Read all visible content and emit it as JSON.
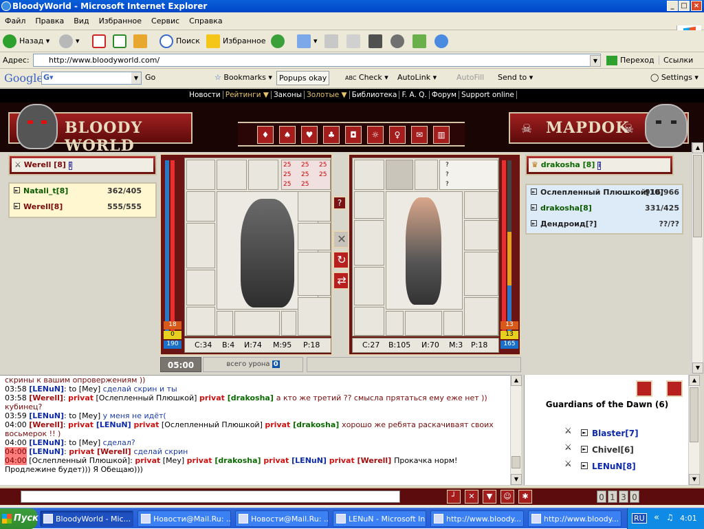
{
  "window": {
    "title": "BloodyWorld - Microsoft Internet Explorer",
    "min": "_",
    "max": "□",
    "close": "×"
  },
  "menu": [
    "Файл",
    "Правка",
    "Вид",
    "Избранное",
    "Сервис",
    "Справка"
  ],
  "toolbar": {
    "back": "Назад",
    "search": "Поиск",
    "favorites": "Избранное"
  },
  "address": {
    "label": "Адрес:",
    "url": "http://www.bloodyworld.com/",
    "go": "Переход",
    "links": "Ссылки"
  },
  "google": {
    "logo": "Google",
    "go": "Go",
    "bookmarks": "Bookmarks",
    "popups": "Popups okay",
    "check": "Check",
    "autolink": "AutoLink",
    "autofill": "AutoFill",
    "sendto": "Send to",
    "settings": "Settings"
  },
  "topnav": [
    "Новости",
    "Рейтинги ▼",
    "Законы",
    "Золотые ▼",
    "Библиотека",
    "F. A. Q.",
    "Форум",
    "Support online"
  ],
  "banner": {
    "left_title": "BLOODY WORLD",
    "right_title": "MAPDOK"
  },
  "navbuttons": [
    "♦",
    "♠",
    "♥",
    "♣",
    "◘",
    "☼",
    "♀",
    "✉",
    "▥"
  ],
  "left_player": {
    "name": "Werell [8]"
  },
  "right_player": {
    "name": "drakosha [8]"
  },
  "left_team": [
    {
      "name": "Natali_t[8]",
      "hp": "362/405"
    },
    {
      "name": "Werell[8]",
      "hp": "555/555"
    }
  ],
  "right_team": [
    {
      "name": "Ослепленный Плюшкой[10]",
      "hp": "916/966"
    },
    {
      "name": "drakosha[8]",
      "hp": "331/425"
    },
    {
      "name": "Дендроид[?]",
      "hp": "??/??"
    }
  ],
  "left_char": {
    "hp": "190",
    "mana": "0",
    "bar_top": "18",
    "stats": {
      "s": "С:34",
      "v": "В:4",
      "i": "И:74",
      "m": "М:95",
      "r": "Р:18"
    },
    "buff": "25"
  },
  "right_char": {
    "hp": "165",
    "mana": "13",
    "bar_top": "13",
    "stats": {
      "s": "С:27",
      "v": "В:105",
      "i": "И:70",
      "m": "М:3",
      "r": "Р:18"
    },
    "unknown": "?"
  },
  "mid": {
    "help": "?",
    "b1": "✕",
    "b2": "↻",
    "b3": "⇄"
  },
  "timer": "05:00",
  "damage": {
    "label": "всего урона",
    "value": "0"
  },
  "chat": [
    {
      "time": "",
      "parts": [
        {
          "t": "скрины к вашим опровержениям ))",
          "c": "msg"
        }
      ]
    },
    {
      "time": "03:58",
      "parts": [
        {
          "t": "[LENuN]",
          "c": "usr"
        },
        {
          "t": ": ",
          "c": "blk"
        },
        {
          "t": "to",
          "c": "blk"
        },
        {
          "t": " [Мey] ",
          "c": "blk"
        },
        {
          "t": "сделай скрин и ты",
          "c": "msgb"
        }
      ]
    },
    {
      "time": "03:58",
      "parts": [
        {
          "t": "[Werell]",
          "c": "usr2"
        },
        {
          "t": ": ",
          "c": "blk"
        },
        {
          "t": "privat",
          "c": "priv"
        },
        {
          "t": " [Ослепленный Плюшкой] ",
          "c": "blk"
        },
        {
          "t": "privat",
          "c": "priv"
        },
        {
          "t": " [drakosha] ",
          "c": "gr"
        },
        {
          "t": "а кто же третий ?? смысла прятаться ему еже нет )) кубинец?",
          "c": "msg"
        }
      ]
    },
    {
      "time": "03:59",
      "parts": [
        {
          "t": "[LENuN]",
          "c": "usr"
        },
        {
          "t": ": ",
          "c": "blk"
        },
        {
          "t": "to",
          "c": "blk"
        },
        {
          "t": " [Мey] ",
          "c": "blk"
        },
        {
          "t": "у меня не идёт(",
          "c": "msgb"
        }
      ]
    },
    {
      "time": "04:00",
      "parts": [
        {
          "t": "[Werell]",
          "c": "usr2"
        },
        {
          "t": ": ",
          "c": "blk"
        },
        {
          "t": "privat",
          "c": "priv"
        },
        {
          "t": " [LENuN] ",
          "c": "usr"
        },
        {
          "t": "privat",
          "c": "priv"
        },
        {
          "t": " [Ослепленный Плюшкой] ",
          "c": "blk"
        },
        {
          "t": "privat",
          "c": "priv"
        },
        {
          "t": " [drakosha] ",
          "c": "gr"
        },
        {
          "t": "хорошо же ребята раскачиваят своих восьмерок !! )",
          "c": "msg"
        }
      ]
    },
    {
      "time": "04:00",
      "parts": [
        {
          "t": "[LENuN]",
          "c": "usr"
        },
        {
          "t": ": ",
          "c": "blk"
        },
        {
          "t": "to",
          "c": "blk"
        },
        {
          "t": " [Мey] ",
          "c": "blk"
        },
        {
          "t": "сделал?",
          "c": "msgb"
        }
      ]
    },
    {
      "time": "04:00",
      "hl": true,
      "parts": [
        {
          "t": "[LENuN]",
          "c": "usr"
        },
        {
          "t": ": ",
          "c": "blk"
        },
        {
          "t": "privat",
          "c": "priv"
        },
        {
          "t": " [Werell] ",
          "c": "usr2"
        },
        {
          "t": "сделай скрин",
          "c": "msgb"
        }
      ]
    },
    {
      "time": "04:00",
      "hl": true,
      "parts": [
        {
          "t": "[Ослепленный Плюшкой]",
          "c": "blk"
        },
        {
          "t": ": ",
          "c": "blk"
        },
        {
          "t": "privat",
          "c": "priv"
        },
        {
          "t": " [Мey] ",
          "c": "blk"
        },
        {
          "t": "privat",
          "c": "priv"
        },
        {
          "t": " [drakosha] ",
          "c": "gr"
        },
        {
          "t": "privat",
          "c": "priv"
        },
        {
          "t": " [LENuN] ",
          "c": "usr"
        },
        {
          "t": "privat",
          "c": "priv"
        },
        {
          "t": " [Werell] ",
          "c": "usr2"
        },
        {
          "t": "Прокачка норм! Продлежине будет))) Я Обещаю)))",
          "c": "blk"
        }
      ]
    }
  ],
  "guild": {
    "title": "Guardians of the Dawn (6)",
    "members": [
      {
        "name": "Blaster[7]",
        "color": "#0d2aa8"
      },
      {
        "name": "Chivel[6]",
        "color": "#333333"
      },
      {
        "name": "LENuN[8]",
        "color": "#0d2aa8"
      }
    ]
  },
  "bottom": {
    "clock": [
      "0",
      "1",
      "3",
      "0"
    ]
  },
  "taskbar": {
    "start": "Пуск",
    "tasks": [
      "BloodyWorld - Mic...",
      "Новости@Mail.Ru: ...",
      "Новости@Mail.Ru: ...",
      "LENuN - Microsoft In...",
      "http://www.bloody...",
      "http://www.bloody..."
    ],
    "lang": "RU",
    "time": "4:01"
  }
}
